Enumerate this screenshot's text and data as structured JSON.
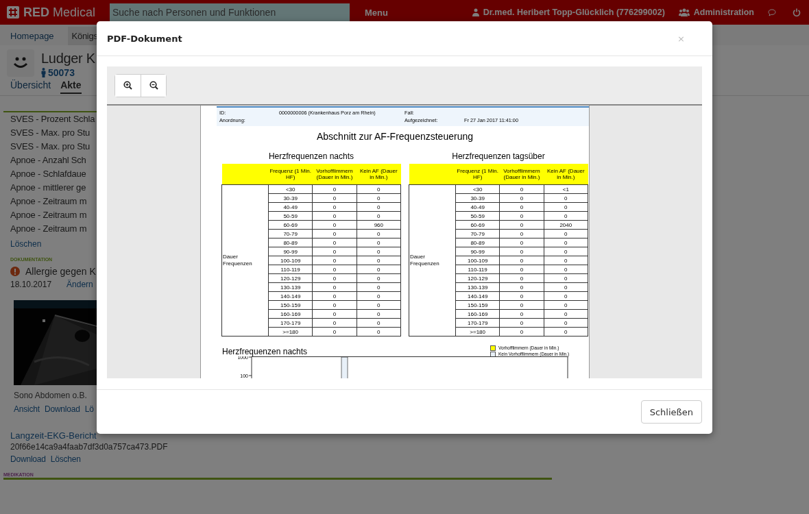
{
  "topbar": {
    "brand_bold": "RED",
    "brand_rest": "Medical",
    "search": {
      "placeholder": "Suche nach Personen und Funktionen"
    },
    "menu": "Menu",
    "user": "Dr.med. Heribert Topp-Glücklich (776299002)",
    "admin": "Administration"
  },
  "nav_tabs": [
    {
      "label": "Homepage",
      "selected": false
    },
    {
      "label": "Königs",
      "selected": true
    }
  ],
  "patient": {
    "name": "Ludger K",
    "id": "50073"
  },
  "record_tabs": [
    {
      "label": "Übersicht",
      "selected": false
    },
    {
      "label": "Akte",
      "selected": true
    }
  ],
  "findings": [
    "SVES - Prozent Schla",
    "SVES - Max. pro Stu",
    "SVES - Max. pro Stu",
    "Apnoe - Anzahl Sch",
    "Apnoe - Schlafdaue",
    "Apnoe - mittlerer ge",
    "Apnoe - Zeitraum m",
    "Apnoe - Zeitraum m",
    "Apnoe - Zeitraum m"
  ],
  "findings_action": "Löschen",
  "documentation": {
    "heading": "DOKUMENTATION",
    "entry": {
      "title": "Allergie gegen K",
      "date": "18.10.2017",
      "action": "Ändern"
    },
    "image": {
      "kind": "picture",
      "caption": "Sono Abdomen o.B.",
      "actions": [
        "Ansicht",
        "Download",
        "Lö"
      ]
    },
    "file": {
      "title": "Langzeit-EKG-Bericht",
      "filename": "20f66e14ca9a4faab7df3d0a757ca473.PDF",
      "actions": [
        "Download",
        "Löschen"
      ]
    }
  },
  "medication": {
    "heading": "MEDIKATION"
  },
  "modal": {
    "title": "PDF-Dokument",
    "close": "×",
    "footer_button": "Schließen",
    "pdf": {
      "info": [
        {
          "label": "ID:",
          "value": "0000000006 (Krankenhaus Porz am Rhein)",
          "label2": "Fall:"
        },
        {
          "label": "Anordnung:",
          "label2": "Aufgezeichnet:",
          "value2": "Fr 27 Jan 2017 11:41:00"
        }
      ],
      "title": "Abschnitt zur AF-Frequenzsteuerung",
      "tables": [
        {
          "title": "Herzfrequenzen nachts",
          "columns": [
            "Frequenz (1 Min. HF)",
            "Vorhofflimmern (Dauer in Min.)",
            "Kein AF (Dauer in Min.)"
          ],
          "row_label": "Dauer Frequenzen",
          "rows": [
            [
              "<30",
              "0",
              "0"
            ],
            [
              "30-39",
              "0",
              "0"
            ],
            [
              "40-49",
              "0",
              "0"
            ],
            [
              "50-59",
              "0",
              "0"
            ],
            [
              "60-69",
              "0",
              "960"
            ],
            [
              "70-79",
              "0",
              "0"
            ],
            [
              "80-89",
              "0",
              "0"
            ],
            [
              "90-99",
              "0",
              "0"
            ],
            [
              "100-109",
              "0",
              "0"
            ],
            [
              "110-119",
              "0",
              "0"
            ],
            [
              "120-129",
              "0",
              "0"
            ],
            [
              "130-139",
              "0",
              "0"
            ],
            [
              "140-149",
              "0",
              "0"
            ],
            [
              "150-159",
              "0",
              "0"
            ],
            [
              "160-169",
              "0",
              "0"
            ],
            [
              "170-179",
              "0",
              "0"
            ],
            [
              ">=180",
              "0",
              "0"
            ]
          ]
        },
        {
          "title": "Herzfrequenzen tagsüber",
          "columns": [
            "Frequenz (1 Min. HF)",
            "Vorhofflimmern (Dauer in Min.)",
            "Kein AF (Dauer in Min.)"
          ],
          "row_label": "Dauer Frequenzen",
          "rows": [
            [
              "<30",
              "0",
              "<1"
            ],
            [
              "30-39",
              "0",
              "0"
            ],
            [
              "40-49",
              "0",
              "0"
            ],
            [
              "50-59",
              "0",
              "0"
            ],
            [
              "60-69",
              "0",
              "2040"
            ],
            [
              "70-79",
              "0",
              "0"
            ],
            [
              "80-89",
              "0",
              "0"
            ],
            [
              "90-99",
              "0",
              "0"
            ],
            [
              "100-109",
              "0",
              "0"
            ],
            [
              "110-119",
              "0",
              "0"
            ],
            [
              "120-129",
              "0",
              "0"
            ],
            [
              "130-139",
              "0",
              "0"
            ],
            [
              "140-149",
              "0",
              "0"
            ],
            [
              "150-159",
              "0",
              "0"
            ],
            [
              "160-169",
              "0",
              "0"
            ],
            [
              "170-179",
              "0",
              "0"
            ],
            [
              ">=180",
              "0",
              "0"
            ]
          ]
        }
      ],
      "chart": {
        "title": "Herzfrequenzen nachts",
        "legend": [
          {
            "label": "Vorhofflimmern (Dauer in Min.)",
            "color": "#ffff00"
          },
          {
            "label": "Kein Vorhofflimmern (Dauer in Min.)",
            "color": "#e8f0f8"
          }
        ],
        "ytick_labels": [
          "1000",
          "100"
        ]
      }
    }
  }
}
